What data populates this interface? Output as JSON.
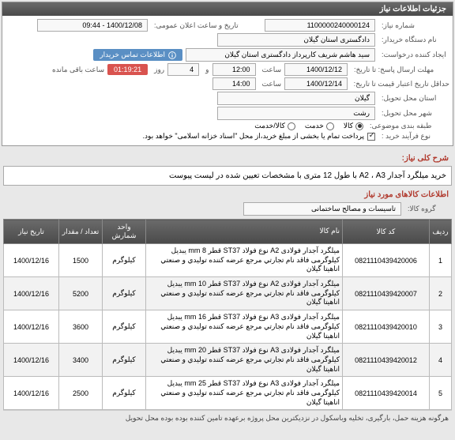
{
  "panel": {
    "title": "جزئیات اطلاعات نیاز"
  },
  "info": {
    "need_no_label": "شماره نیاز:",
    "need_no": "1100000240000124",
    "public_time_label": "تاریخ و ساعت اعلان عمومی:",
    "public_time": "1400/12/08 - 09:44",
    "buyer_label": "نام دستگاه خریدار:",
    "buyer": "دادگستری استان گیلان",
    "requester_label": "ایجاد کننده درخواست:",
    "requester": "سید هاشم شریف کارپرداز دادگستری استان گیلان",
    "contact_badge": "اطلاعات تماس خریدار",
    "deadline_label": "مهلت ارسال پاسخ:  تا تاریخ:",
    "deadline_date": "1400/12/12",
    "time_label": "ساعت",
    "deadline_time": "12:00",
    "and_label": "و",
    "days": "4",
    "day_label": "روز",
    "countdown": "01:19:21",
    "remain_label": "ساعت باقی مانده",
    "validity_label": "حداقل تاریخ اعتبار قیمت تا تاریخ:",
    "validity_date": "1400/12/14",
    "validity_time": "14:00",
    "province_label": "استان محل تحویل:",
    "province": "گیلان",
    "city_label": "شهر محل تحویل:",
    "city": "رشت",
    "category_label": "طبقه بندی موضوعی:",
    "cat_goods": "کالا",
    "cat_service": "خدمت",
    "cat_both": "کالا/خدمت",
    "buy_process_label": "نوع فرآیند خرید :",
    "buy_process_note": "پرداخت تمام یا بخشی از مبلغ خرید،از محل \"اسناد خزانه اسلامی\" خواهد بود."
  },
  "desc": {
    "label": "شرح کلی نیاز:",
    "text": "خرید میلگرد آجدار A2 ، A3 با طول 12 متری با مشخصات تعیین شده در لیست پیوست"
  },
  "items": {
    "section": "اطلاعات کالاهای مورد نیاز",
    "group_label": "گروه کالا:",
    "group": "تاسیسات و مصالح ساختمانی",
    "headers": {
      "idx": "ردیف",
      "code": "کد کالا",
      "name": "نام کالا",
      "unit": "واحد شمارش",
      "qty": "تعداد / مقدار",
      "date": "تاریخ نیاز"
    },
    "rows": [
      {
        "idx": "1",
        "code": "0821110439420006",
        "name": "میلگرد آجدار فولادی A2 نوع فولاد ST37 قطر 8 mm یبدیل کیلوگرمی فاقد نام تجارتي مرجع عرضه كننده توليدي و صنعتي اناهيتا گيلان",
        "unit": "کیلوگرم",
        "qty": "1500",
        "date": "1400/12/16"
      },
      {
        "idx": "2",
        "code": "0821110439420007",
        "name": "میلگرد آجدار فولادی A2 نوع فولاد ST37 قطر 10 mm یبدیل کیلوگرمی فاقد نام تجارتي مرجع عرضه كننده توليدي و صنعتي اناهيتا گيلان",
        "unit": "کیلوگرم",
        "qty": "5200",
        "date": "1400/12/16"
      },
      {
        "idx": "3",
        "code": "0821110439420010",
        "name": "میلگرد آجدار فولادی A3 نوع فولاد ST37 قطر 16 mm یبدیل کیلوگرمی فاقد نام تجارتي مرجع عرضه كننده توليدي و صنعتي اناهيتا گيلان",
        "unit": "کیلوگرم",
        "qty": "3600",
        "date": "1400/12/16"
      },
      {
        "idx": "4",
        "code": "0821110439420012",
        "name": "میلگرد آجدار فولادی A3 نوع فولاد ST37 قطر 20 mm یبدیل کیلوگرمی فاقد نام تجارتي مرجع عرضه كننده توليدي و صنعتي اناهيتا گيلان",
        "unit": "کیلوگرم",
        "qty": "3400",
        "date": "1400/12/16"
      },
      {
        "idx": "5",
        "code": "0821110439420014",
        "name": "میلگرد آجدار فولادی A3 نوع فولاد ST37 قطر 25 mm یبدیل کیلوگرمی فاقد نام تجارتي مرجع عرضه كننده توليدي و صنعتي اناهيتا گيلان",
        "unit": "کیلوگرم",
        "qty": "2500",
        "date": "1400/12/16"
      }
    ],
    "footer": "هرگونه هزینه حمل، بارگیری، تخلیه وباسکول در نزدیکترین محل پروژه برعهده تامین کننده بوده بوده محل تحویل"
  }
}
